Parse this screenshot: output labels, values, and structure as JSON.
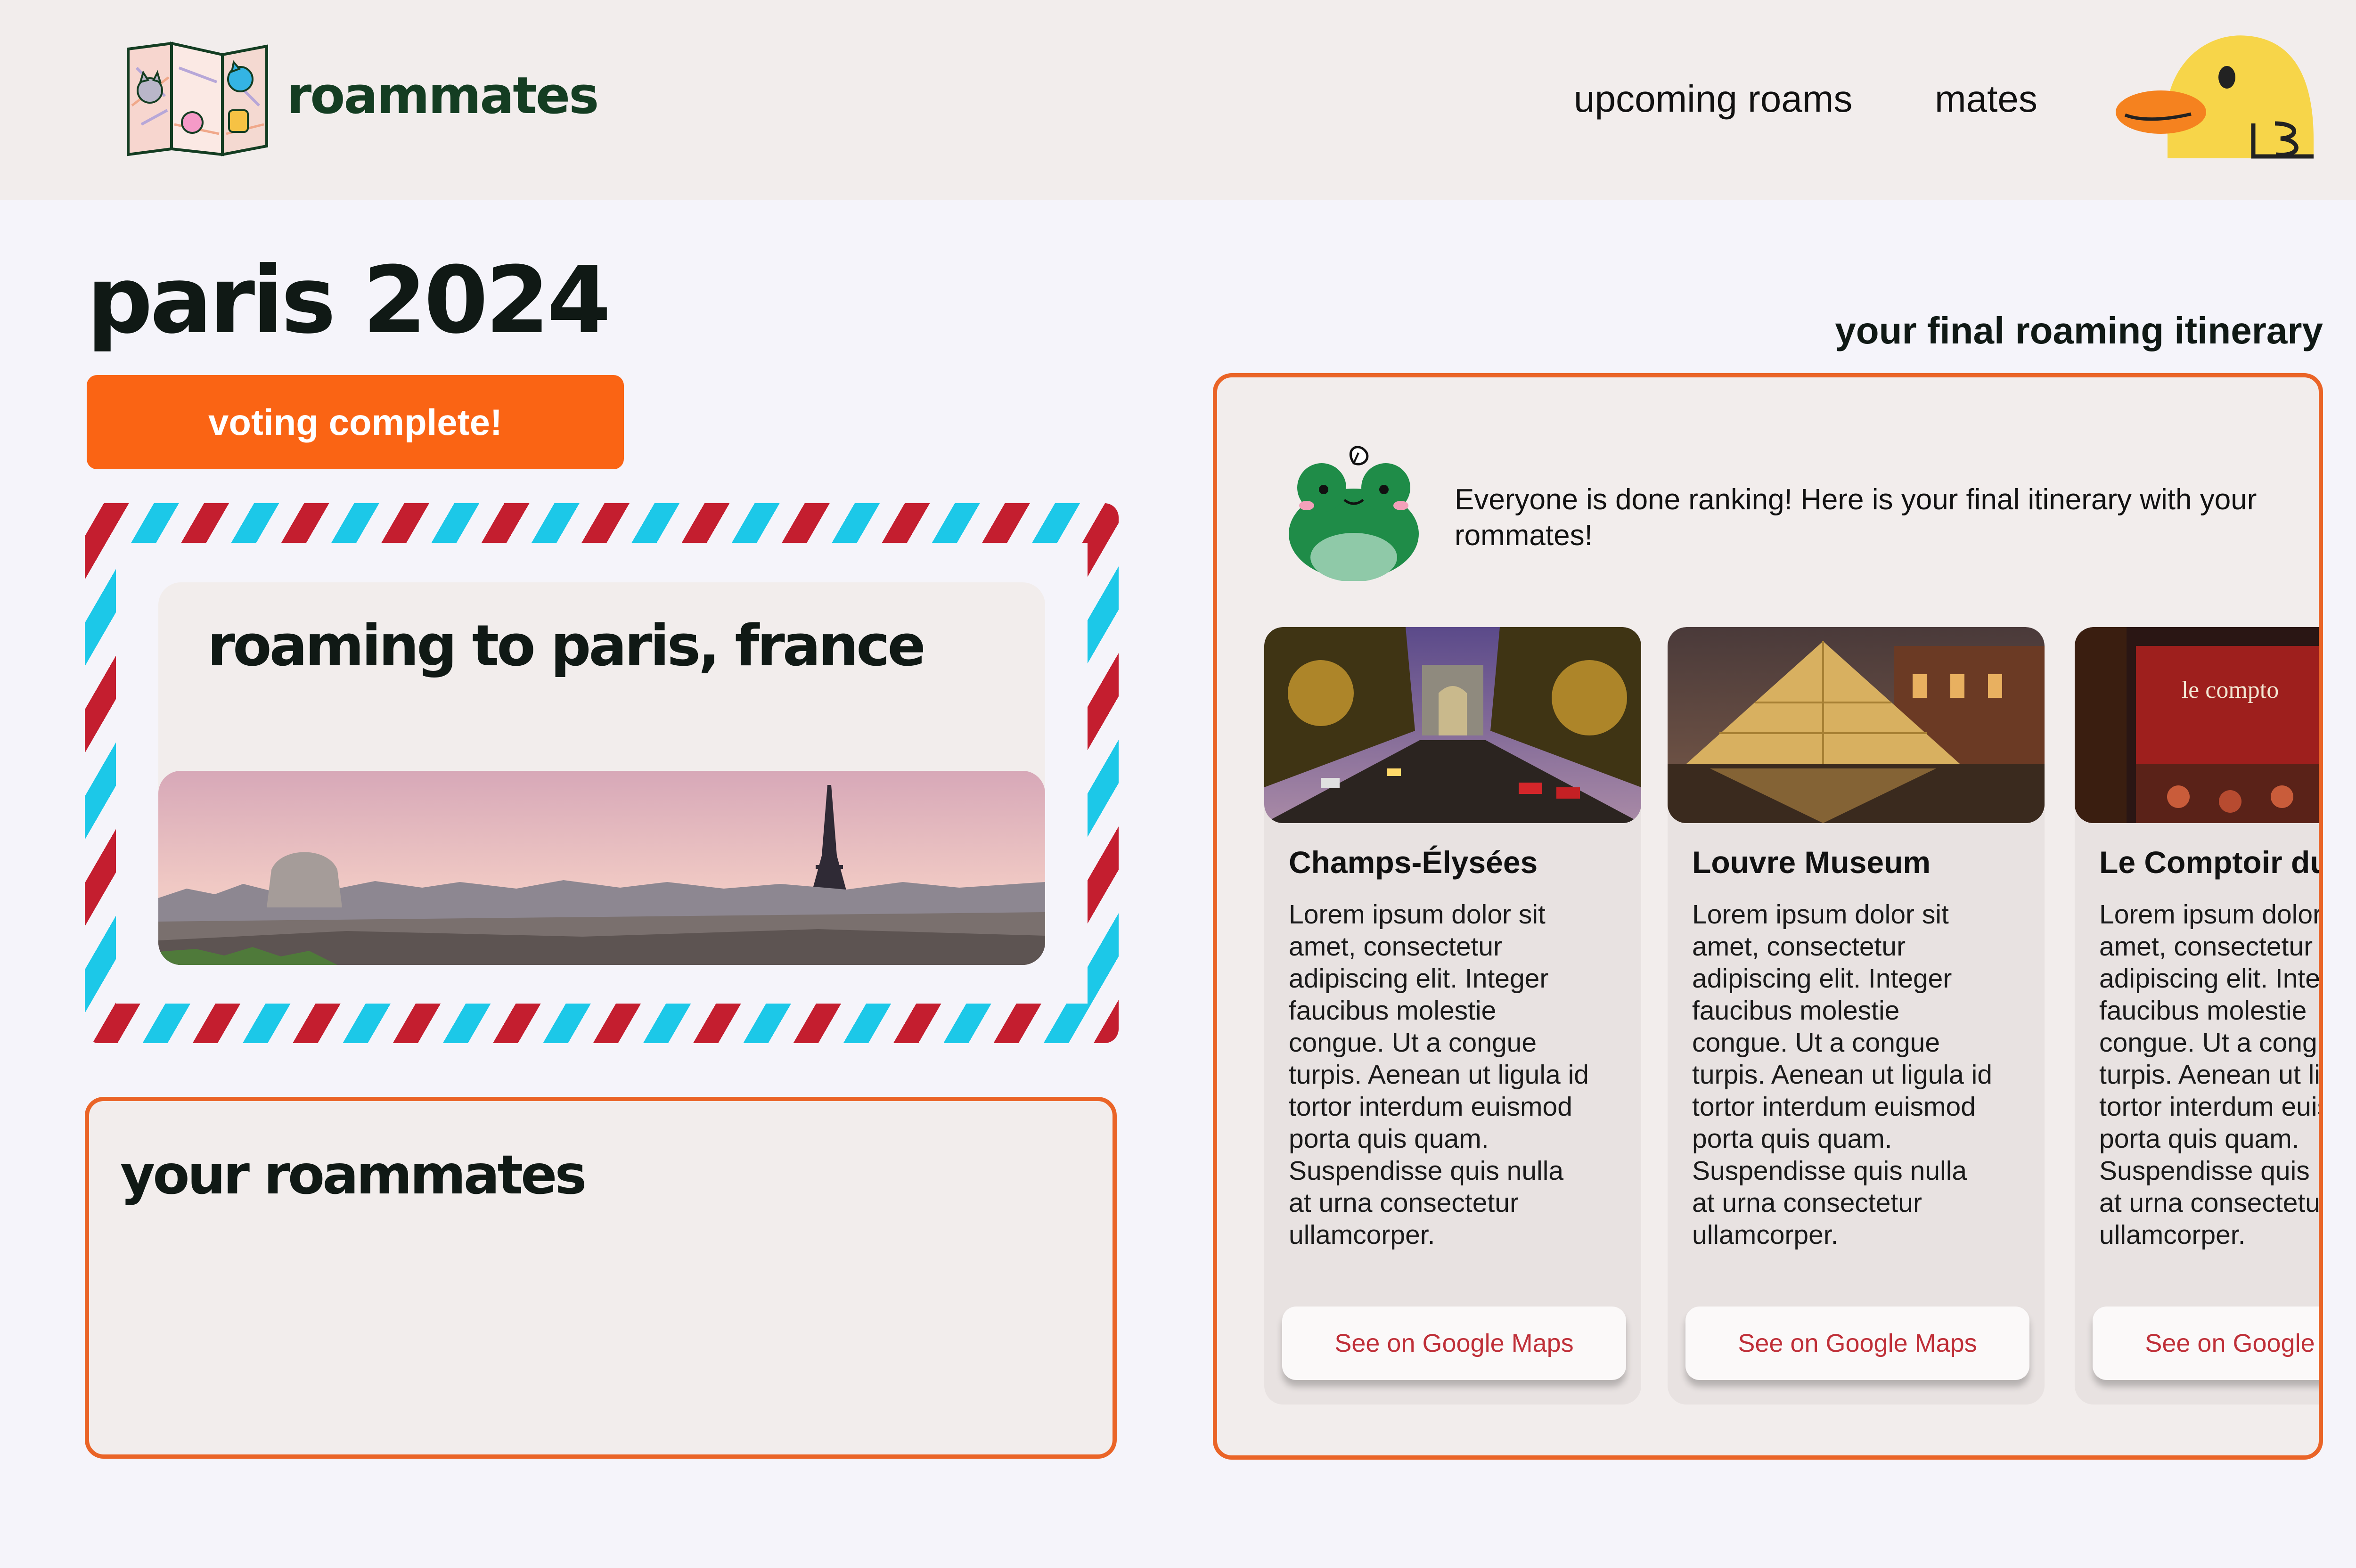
{
  "header": {
    "brand": "roammates",
    "nav": {
      "upcoming": "upcoming roams",
      "mates": "mates"
    },
    "logo_icon": "folded-map-cats-icon",
    "avatar_icon": "duck-avatar-icon"
  },
  "trip": {
    "title": "paris 2024",
    "status": "voting complete!",
    "card_title": "roaming to paris, france"
  },
  "roammates": {
    "title": "your roammates"
  },
  "itinerary": {
    "heading": "your final roaming itinerary",
    "mascot_icon": "frog-mascot-icon",
    "intro": "Everyone is done ranking! Here is your final itinerary with your rommates!",
    "places": [
      {
        "name": "Champs-Élysées",
        "description": "Lorem ipsum dolor sit amet, consectetur adipiscing elit. Integer faucibus molestie congue. Ut a congue turpis. Aenean ut ligula id tortor interdum euismod porta quis quam. Suspendisse quis nulla at urna consectetur ullamcorper.",
        "button": "See on Google Maps"
      },
      {
        "name": "Louvre Museum",
        "description": "Lorem ipsum dolor sit amet, consectetur adipiscing elit. Integer faucibus molestie congue. Ut a congue turpis. Aenean ut ligula id tortor interdum euismod porta quis quam. Suspendisse quis nulla at urna consectetur ullamcorper.",
        "button": "See on Google Maps"
      },
      {
        "name": "Le Comptoir du",
        "description": "Lorem ipsum dolor sit amet, consectetur adipiscing elit. Integer faucibus molestie congue. Ut a congue turpis. Aenean ut ligula id tortor interdum euismod porta quis quam. Suspendisse quis nulla at urna consectetur ullamcorper.",
        "button": "See on Google Maps",
        "sign": "le compto"
      }
    ]
  },
  "colors": {
    "accent_orange": "#fa6414",
    "brand_green": "#143d22",
    "airmail_red": "#c41e2f",
    "airmail_blue": "#1cc8e8",
    "link_red": "#bf2f38"
  }
}
